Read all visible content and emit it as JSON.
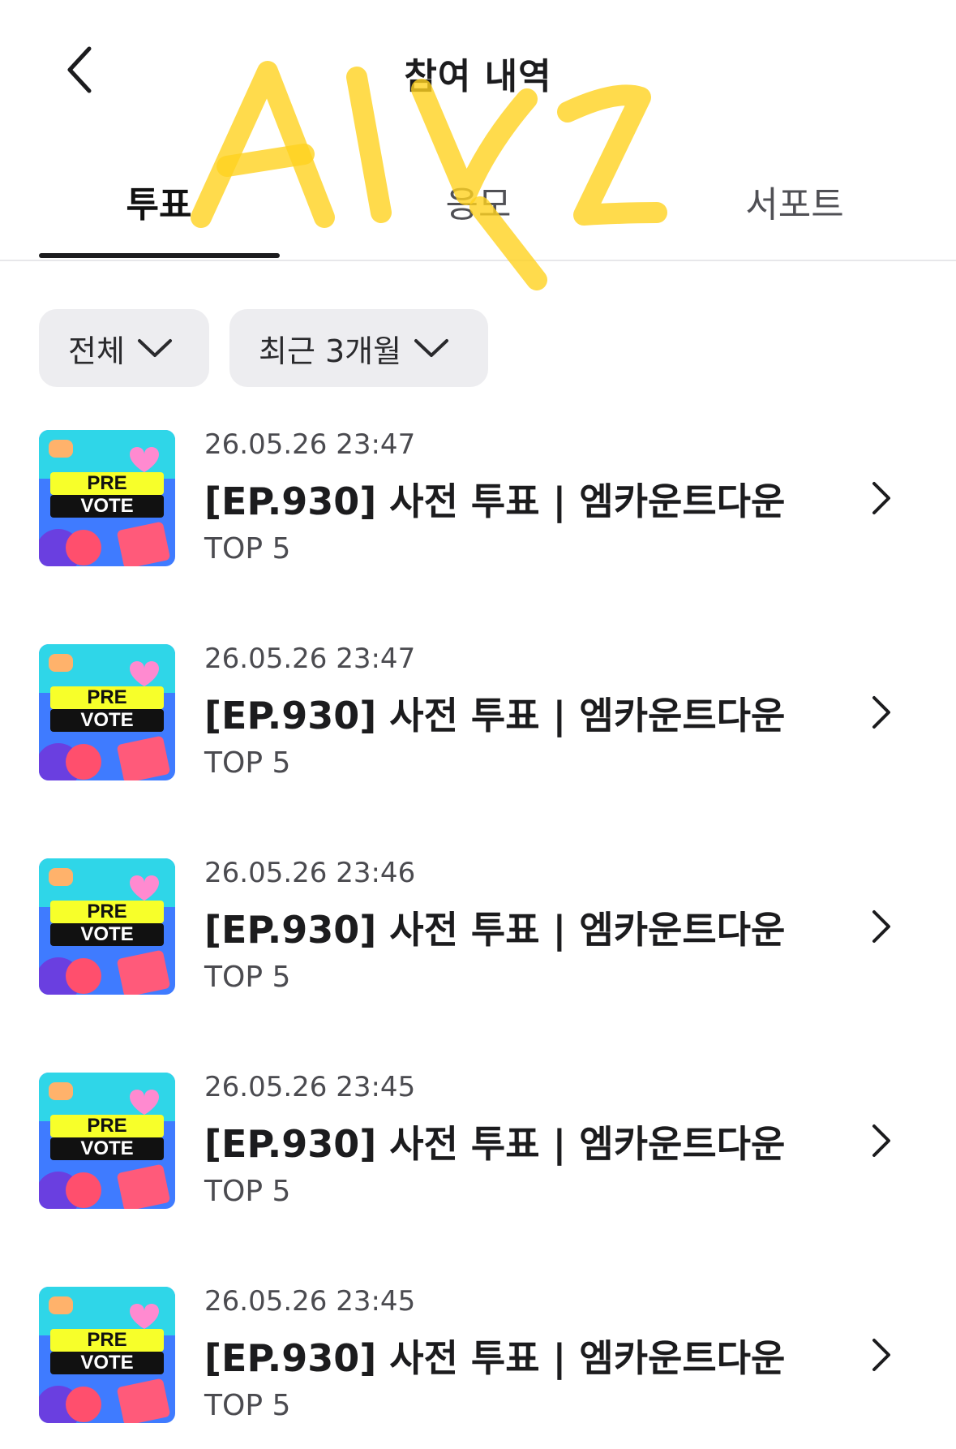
{
  "header": {
    "title": "참여 내역",
    "back_icon": "chevron-left-icon"
  },
  "tabs": [
    {
      "label": "투표",
      "active": true
    },
    {
      "label": "응모",
      "active": false
    },
    {
      "label": "서포트",
      "active": false
    }
  ],
  "filters": {
    "type": {
      "label": "전체",
      "icon": "chevron-down-icon"
    },
    "period": {
      "label": "최근 3개월",
      "icon": "chevron-down-icon"
    }
  },
  "thumbnail": {
    "line1": "PRE",
    "line2": "VOTE"
  },
  "list": [
    {
      "date": "26.05.26 23:47",
      "title": "[EP.930] 사전 투표 | 엠카운트다운",
      "subtitle": "TOP 5"
    },
    {
      "date": "26.05.26 23:47",
      "title": "[EP.930] 사전 투표 | 엠카운트다운",
      "subtitle": "TOP 5"
    },
    {
      "date": "26.05.26 23:46",
      "title": "[EP.930] 사전 투표 | 엠카운트다운",
      "subtitle": "TOP 5"
    },
    {
      "date": "26.05.26 23:45",
      "title": "[EP.930] 사전 투표 | 엠카운트다운",
      "subtitle": "TOP 5"
    },
    {
      "date": "26.05.26 23:45",
      "title": "[EP.930] 사전 투표 | 엠카운트다운",
      "subtitle": "TOP 5"
    }
  ],
  "colors": {
    "accent": "#1c1c1e",
    "chip_bg": "#ededf0",
    "overlay_scribble": "#ffd21f"
  }
}
